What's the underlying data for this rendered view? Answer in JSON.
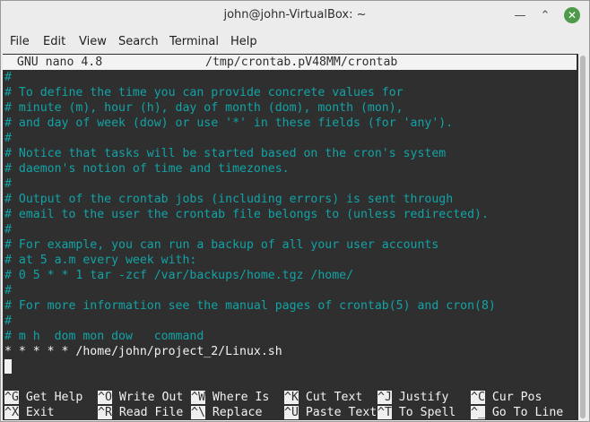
{
  "window": {
    "title": "john@john-VirtualBox: ~"
  },
  "menu": [
    "File",
    "Edit",
    "View",
    "Search",
    "Terminal",
    "Help"
  ],
  "nano": {
    "version": "  GNU nano 4.8",
    "filename": "/tmp/crontab.pV48MM/crontab"
  },
  "editor_lines": [
    "#",
    "# To define the time you can provide concrete values for",
    "# minute (m), hour (h), day of month (dom), month (mon),",
    "# and day of week (dow) or use '*' in these fields (for 'any').",
    "#",
    "# Notice that tasks will be started based on the cron's system",
    "# daemon's notion of time and timezones.",
    "#",
    "# Output of the crontab jobs (including errors) is sent through",
    "# email to the user the crontab file belongs to (unless redirected).",
    "#",
    "# For example, you can run a backup of all your user accounts",
    "# at 5 a.m every week with:",
    "# 0 5 * * 1 tar -zcf /var/backups/home.tgz /home/",
    "#",
    "# For more information see the manual pages of crontab(5) and cron(8)",
    "#",
    "# m h  dom mon dow   command",
    "* * * * * /home/john/project_2/Linux.sh"
  ],
  "shortcuts_row1": [
    {
      "key": "^G",
      "label": "Get Help"
    },
    {
      "key": "^O",
      "label": "Write Out"
    },
    {
      "key": "^W",
      "label": "Where Is"
    },
    {
      "key": "^K",
      "label": "Cut Text"
    },
    {
      "key": "^J",
      "label": "Justify"
    },
    {
      "key": "^C",
      "label": "Cur Pos"
    }
  ],
  "shortcuts_row2": [
    {
      "key": "^X",
      "label": "Exit"
    },
    {
      "key": "^R",
      "label": "Read File"
    },
    {
      "key": "^\\",
      "label": "Replace"
    },
    {
      "key": "^U",
      "label": "Paste Text"
    },
    {
      "key": "^T",
      "label": "To Spell"
    },
    {
      "key": "^_",
      "label": "Go To Line"
    }
  ],
  "icons": {
    "minimize": "minimize-icon",
    "maximize": "maximize-icon",
    "close": "close-icon"
  },
  "colors": {
    "terminal_bg": "#2f2f2f",
    "comment": "#12a3a6",
    "text": "#f2f2f2",
    "close_button": "#4e9a4a"
  }
}
